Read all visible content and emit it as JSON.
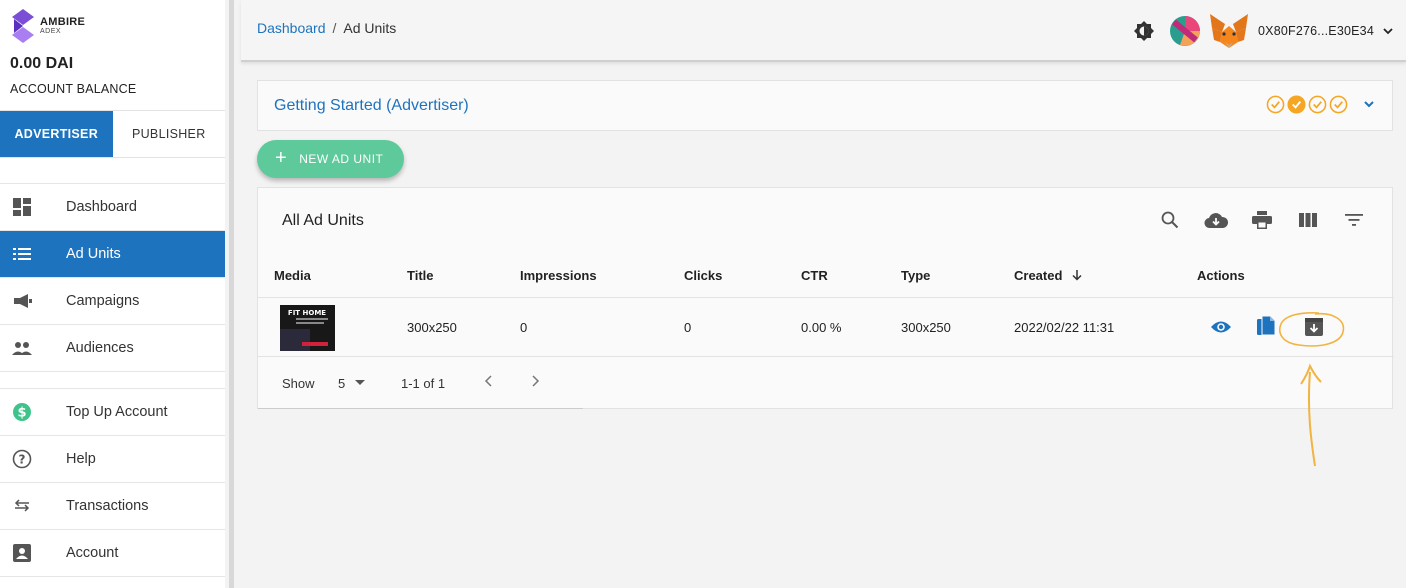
{
  "brand": {
    "name": "AMBIRE",
    "sub": "ADEX"
  },
  "account": {
    "balance": "0.00 DAI",
    "balance_label": "ACCOUNT BALANCE"
  },
  "role_tabs": [
    {
      "label": "ADVERTISER",
      "active": true
    },
    {
      "label": "PUBLISHER",
      "active": false
    }
  ],
  "nav_primary": [
    {
      "label": "Dashboard",
      "icon": "dashboard-icon",
      "active": false
    },
    {
      "label": "Ad Units",
      "icon": "list-icon",
      "active": true
    },
    {
      "label": "Campaigns",
      "icon": "megaphone-icon",
      "active": false
    },
    {
      "label": "Audiences",
      "icon": "people-icon",
      "active": false
    }
  ],
  "nav_secondary": [
    {
      "label": "Top Up Account",
      "icon": "dollar-icon"
    },
    {
      "label": "Help",
      "icon": "help-icon"
    },
    {
      "label": "Transactions",
      "icon": "swap-icon"
    },
    {
      "label": "Account",
      "icon": "account-box-icon"
    }
  ],
  "header": {
    "breadcrumb_link": "Dashboard",
    "breadcrumb_sep": "/",
    "breadcrumb_current": "Ad Units",
    "address": "0X80F276...E30E34"
  },
  "getting_started": {
    "title": "Getting Started (Advertiser)"
  },
  "new_button": {
    "label": "NEW AD UNIT"
  },
  "table": {
    "title": "All Ad Units",
    "columns": [
      "Media",
      "Title",
      "Impressions",
      "Clicks",
      "CTR",
      "Type",
      "Created",
      "Actions"
    ],
    "rows": [
      {
        "thumb_text": "FIT HOME",
        "title": "300x250",
        "impressions": "0",
        "clicks": "0",
        "ctr": "0.00 %",
        "type": "300x250",
        "created": "2022/02/22 11:31"
      }
    ],
    "footer": {
      "show_label": "Show",
      "page_size": "5",
      "range": "1-1 of 1"
    }
  },
  "colors": {
    "primary": "#1e73be",
    "accent_green": "#5ec99a",
    "annotation": "#f2b441"
  }
}
